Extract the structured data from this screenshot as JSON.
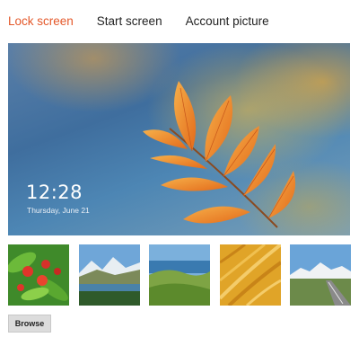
{
  "tabs": [
    {
      "label": "Lock screen",
      "active": true
    },
    {
      "label": "Start screen",
      "active": false
    },
    {
      "label": "Account picture",
      "active": false
    }
  ],
  "lock_preview": {
    "time": "12:28",
    "date": "Thursday, June 21"
  },
  "background_options": [
    {
      "subject": "red flowers with green leaves"
    },
    {
      "subject": "mountain valley with lake"
    },
    {
      "subject": "grassy hills by the sea"
    },
    {
      "subject": "golden grass close-up"
    },
    {
      "subject": "mountain road"
    }
  ],
  "browse_label": "Browse",
  "colors": {
    "active_tab": "#e4582a",
    "tab_text": "#222222",
    "button_bg": "#dcdcdc"
  }
}
